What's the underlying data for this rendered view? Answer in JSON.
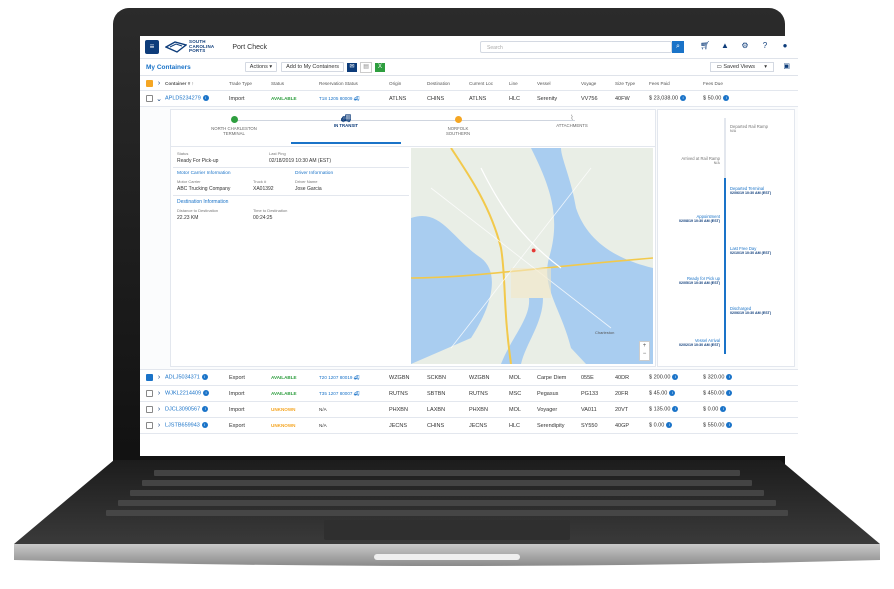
{
  "header": {
    "logo_lines": [
      "SOUTH",
      "CAROLINA",
      "PORTS"
    ],
    "app_name": "Port Check",
    "search_placeholder": "Search"
  },
  "toolbar": {
    "title": "My Containers",
    "actions_label": "Actions",
    "add_label": "Add to My Containers",
    "saved_views_label": "Saved Views"
  },
  "table": {
    "columns": [
      "Container #",
      "Trade Type",
      "Status",
      "Reservation Status",
      "Origin",
      "Destination",
      "Current Loc",
      "Line",
      "Vessel",
      "Voyage",
      "Size Type",
      "Fees Paid",
      "Fees Due"
    ],
    "expanded_row": {
      "container": "APLD5234279",
      "trade": "Import",
      "status": "AVAILABLE",
      "reservation": "T18 1205 80009",
      "origin": "ATLNS",
      "destination": "CHINS",
      "current": "ATLNS",
      "line": "HLC",
      "vessel": "Serenity",
      "voyage": "VV756",
      "size": "40FW",
      "paid": "$ 23,038.00",
      "due": "$ 50.00"
    },
    "rows": [
      {
        "container": "ADLJ5034371",
        "trade": "Export",
        "status": "AVAILABLE",
        "reservation": "T20 1207 80019",
        "origin": "WZGBN",
        "destination": "SCKBN",
        "current": "WZGBN",
        "line": "MOL",
        "vessel": "Carpe Diem",
        "voyage": "055E",
        "size": "40DR",
        "paid": "$ 200.00",
        "due": "$ 320.00",
        "checked": true
      },
      {
        "container": "WJKL2214409",
        "trade": "Import",
        "status": "AVAILABLE",
        "reservation": "T35 1207 80007",
        "origin": "RUTNS",
        "destination": "SBTBN",
        "current": "RUTNS",
        "line": "MSC",
        "vessel": "Pegasus",
        "voyage": "PG133",
        "size": "20FR",
        "paid": "$ 45.00",
        "due": "$ 450.00",
        "checked": false
      },
      {
        "container": "DJCL3090567",
        "trade": "Import",
        "status": "UNKNOWN",
        "reservation": "N/A",
        "origin": "PHXBN",
        "destination": "LAXBN",
        "current": "PHXBN",
        "line": "MOL",
        "vessel": "Voyager",
        "voyage": "VA011",
        "size": "20VT",
        "paid": "$ 135.00",
        "due": "$ 0.00",
        "checked": false
      },
      {
        "container": "LJSTB659943",
        "trade": "Export",
        "status": "UNKNOWN",
        "reservation": "N/A",
        "origin": "JECNS",
        "destination": "CHINS",
        "current": "JECNS",
        "line": "HLC",
        "vessel": "Serendipity",
        "voyage": "SY550",
        "size": "40GP",
        "paid": "$ 0.00",
        "due": "$ 550.00",
        "checked": false
      }
    ]
  },
  "detail": {
    "steps": [
      {
        "label_1": "NORTH CHARLESTON",
        "label_2": "TERMINAL"
      },
      {
        "label_1": "IN TRANSIT",
        "label_2": ""
      },
      {
        "label_1": "NORFOLK",
        "label_2": "SOUTHERN"
      },
      {
        "label_1": "ATTACHMENTS",
        "label_2": ""
      }
    ],
    "status_label": "Status",
    "status_value": "Ready For Pick-up",
    "last_ping_label": "Last Ping",
    "last_ping_value": "02/18/2019 10:30 AM (EST)",
    "motor_header": "Motor Carrier Information",
    "driver_header": "Driver Information",
    "carrier_label": "Motor Carrier",
    "carrier_value": "ABC Trucking Company",
    "truck_label": "Truck #",
    "truck_value": "XA01392",
    "driver_label": "Driver Name",
    "driver_value": "Jose Garcia",
    "dest_header": "Destination Information",
    "distance_label": "Distance to Destination",
    "distance_value": "22.23 KM",
    "time_label": "Time to Destination",
    "time_value": "00:24:25",
    "map_place": "Charleston"
  },
  "timeline": {
    "left": [
      {
        "label": "Arrived at Rail Ramp",
        "sub": "N/A"
      },
      {
        "label": "Appointment",
        "sub": "02/08/19 10:30 AM (EST)"
      },
      {
        "label": "Ready for Pick up",
        "sub": "02/05/19 10:30 AM (EST)"
      },
      {
        "label": "Vessel Arrival",
        "sub": "02/02/19 10:30 AM (EST)"
      }
    ],
    "right": [
      {
        "label": "Departed Rail Ramp",
        "sub": "N/A"
      },
      {
        "label": "Departed Terminal",
        "sub": "02/06/19 10:30 AM (EST)"
      },
      {
        "label": "Last Free Day",
        "sub": "02/10/19 10:30 AM (EST)"
      },
      {
        "label": "Discharged",
        "sub": "02/06/19 10:30 AM (EST)"
      }
    ]
  },
  "colors": {
    "navy": "#0d3c7a",
    "accent": "#1a73c8",
    "available": "#2e9e3f",
    "unknown": "#f5a623"
  }
}
